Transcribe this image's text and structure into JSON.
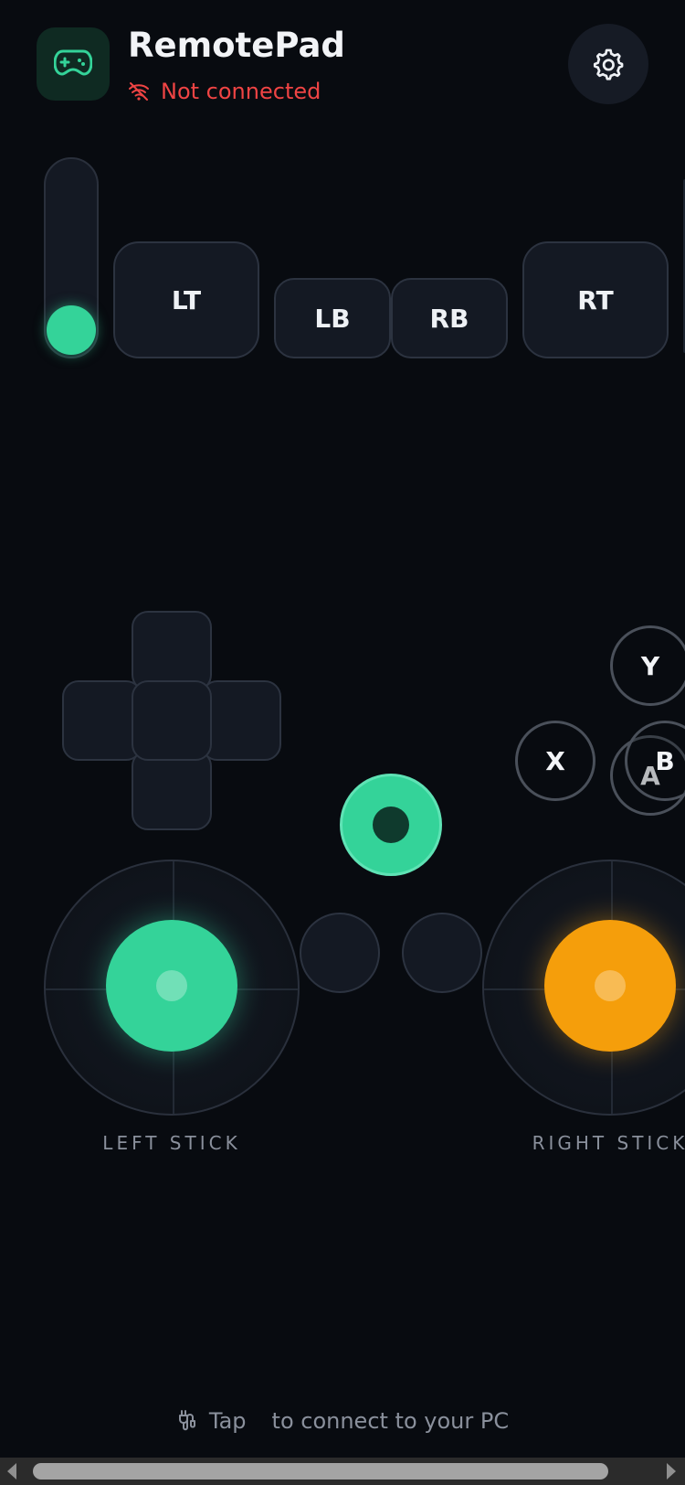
{
  "header": {
    "app_icon": "gamepad-icon",
    "title": "RemotePad",
    "status": {
      "icon": "wifi-off-icon",
      "text": "Not connected",
      "color": "#ef4444"
    },
    "settings_icon": "gear-icon"
  },
  "controls": {
    "slider_level": 0.0,
    "shoulder": {
      "lt": "LT",
      "lb": "LB",
      "rb": "RB",
      "rt": "RT"
    },
    "face": {
      "y": "Y",
      "x": "X",
      "a": "A",
      "b": "B"
    },
    "left_stick_label": "LEFT STICK",
    "right_stick_label": "RIGHT STICK",
    "left_stick_color": "#34d399",
    "right_stick_color": "#f59e0b",
    "accent": "#34d399"
  },
  "footer": {
    "hint_icon": "plug-icon",
    "hint_action": "Tap",
    "hint_text": "to connect to your PC"
  }
}
